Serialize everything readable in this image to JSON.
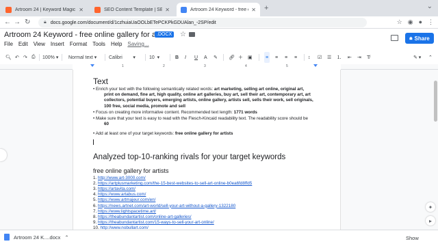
{
  "browser": {
    "tabs": [
      {
        "title": "Artroom 24 | Keyword Magic T",
        "favicon_color": "#ff642d",
        "active": false
      },
      {
        "title": "SEO Content Template | SEMr",
        "favicon_color": "#ff642d",
        "active": false
      },
      {
        "title": "Artroom 24 Keyword - free onl",
        "favicon_color": "#4285f4",
        "active": true
      }
    ],
    "url": "docs.google.com/document/d/1czhuiaUaOOLbETePCKPkGDUAlan_-2SP/edit"
  },
  "doc": {
    "title": "Artroom 24 Keyword - free online gallery for artists",
    "badge": ".DOCX",
    "menu": [
      "File",
      "Edit",
      "View",
      "Insert",
      "Format",
      "Tools",
      "Help"
    ],
    "saving": "Saving...",
    "share_label": "Share"
  },
  "toolbar": {
    "zoom": "100%",
    "style": "Normal text",
    "font": "Calibri",
    "size": "10"
  },
  "content": {
    "heading": "Text",
    "bullet1_prefix": "Enrich your text with the following semantically related words: ",
    "bullet1_words": "art marketing, selling art online, original art,",
    "bullet1_line2": "print on demand, fine art, high quality, online art galleries, buy art, sell their art, contemporary art, art",
    "bullet1_line3": "collectors, potential buyers, emerging artists, online gallery, artists sell, sells their work, sell originals,",
    "bullet1_line4": "100 free, social media, promote and sell",
    "bullet2_prefix": "Focus on creating more informative content. Recommended text length: ",
    "bullet2_value": "1771 words",
    "bullet3_line1": "Make sure that your text is easy to read with the Flesch-Kincaid readability text. The readability score should be",
    "bullet3_value": "60",
    "bullet4_prefix": "Add at least one of your target keywords: ",
    "bullet4_value": "free online gallery for artists",
    "analyze_heading": "Analyzed top-10-ranking rivals for your target keywords",
    "keyword_heading": "free online gallery for artists",
    "links": [
      "http://www.art-3000.com/",
      "https://artplusmarketing.com/the-15-best-websites-to-sell-art-online-b0ea6fd8ffd5",
      "https://artavita.com/",
      "https://www.artabus.com/",
      "https://www.artmajeur.com/en/",
      "https://news.artnet.com/art-world/sell-your-art-without-a-gallery-1322180",
      "https://www.lightspacetime.art/",
      "https://theabundantartist.com/online-art-galleries/",
      "https://theabundantartist.com/15-ways-to-sell-your-art-online/",
      "http://www.nobullart.com/"
    ]
  },
  "download": {
    "file": "Artroom 24 K....docx",
    "show_all": "Show"
  }
}
